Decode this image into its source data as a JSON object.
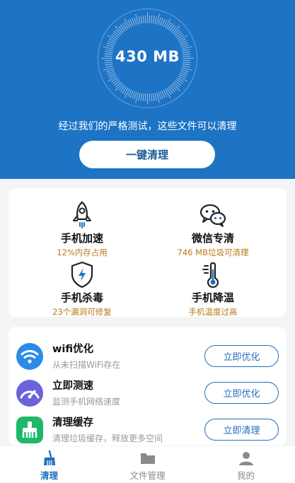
{
  "hero": {
    "size_value": "430 MB",
    "subtitle": "经过我们的严格测试，这些文件可以清理",
    "clean_button": "一键清理"
  },
  "tools": [
    {
      "title": "手机加速",
      "subtitle": "12%内存占用",
      "icon": "rocket-icon"
    },
    {
      "title": "微信专清",
      "subtitle": "746 MB垃圾可清理",
      "icon": "wechat-icon"
    },
    {
      "title": "手机杀毒",
      "subtitle": "23个漏洞可修复",
      "icon": "shield-icon"
    },
    {
      "title": "手机降温",
      "subtitle": "手机温度过高",
      "icon": "thermometer-icon"
    }
  ],
  "list": [
    {
      "title": "wifi优化",
      "subtitle": "从未扫描WiFi存在",
      "button": "立即优化",
      "icon": "wifi-icon"
    },
    {
      "title": "立即测速",
      "subtitle": "监测手机网络速度",
      "button": "立即优化",
      "icon": "speedometer-icon"
    },
    {
      "title": "清理缓存",
      "subtitle": "清理垃圾缓存，释放更多空间",
      "button": "立即清理",
      "icon": "cache-clean-icon"
    }
  ],
  "tabbar": {
    "items": [
      {
        "label": "清理",
        "icon": "broom-icon",
        "active": true
      },
      {
        "label": "文件管理",
        "icon": "folder-icon",
        "active": false
      },
      {
        "label": "我的",
        "icon": "user-icon",
        "active": false
      }
    ]
  },
  "colors": {
    "brand_blue": "#1d73c4",
    "accent_orange": "#b87a1a",
    "button_blue": "#1f6fc0"
  }
}
